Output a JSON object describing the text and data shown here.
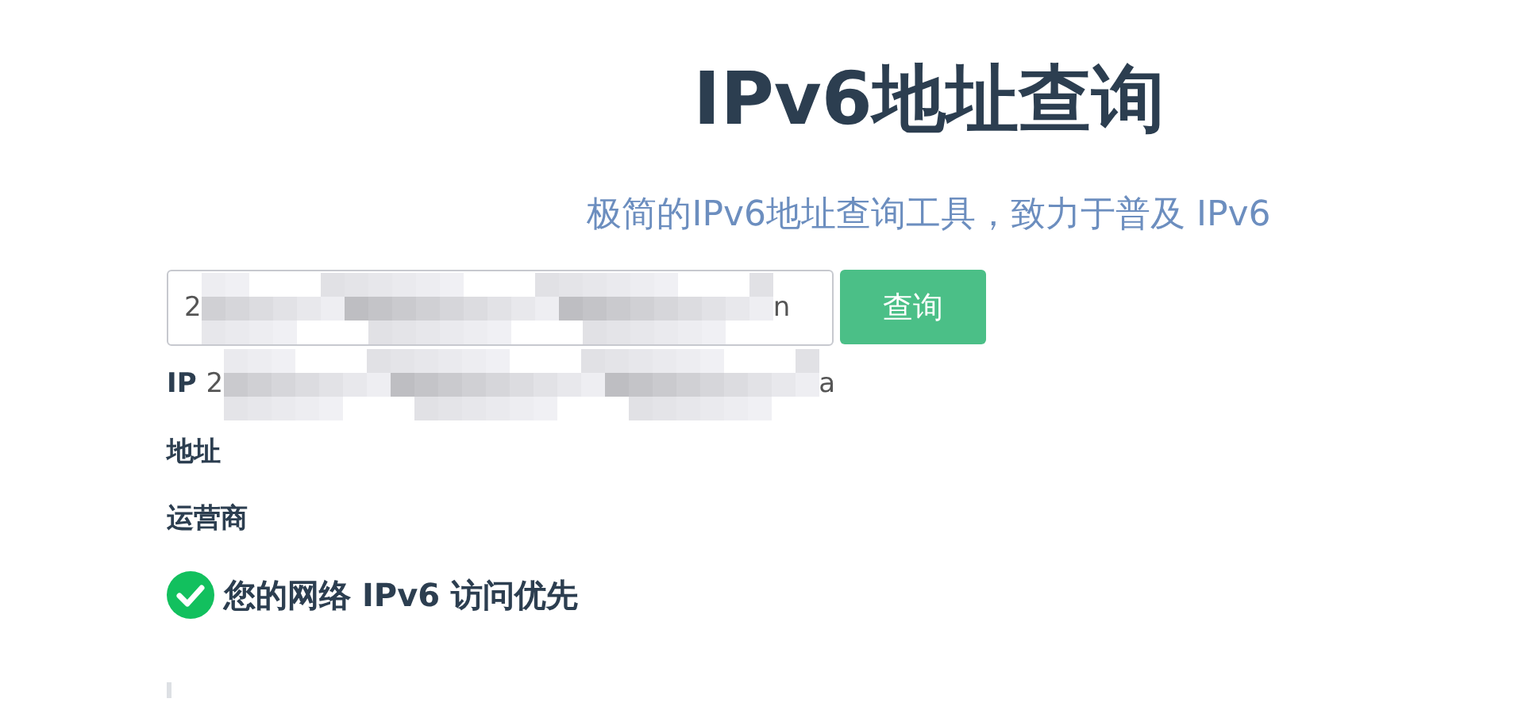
{
  "title": "IPv6地址查询",
  "subtitle": "极简的IPv6地址查询工具，致力于普及 IPv6",
  "search": {
    "value_start": "2",
    "value_end": "n",
    "redacted": true,
    "button": "查询"
  },
  "results": [
    {
      "kind": "ip",
      "label": "IP",
      "value_start": "2",
      "value_end": "a",
      "redacted": true
    },
    {
      "kind": "plain",
      "label": "地址"
    },
    {
      "kind": "plain",
      "label": "运营商"
    }
  ],
  "status": {
    "ok": true,
    "text": "您的网络 IPv6 访问优先"
  }
}
